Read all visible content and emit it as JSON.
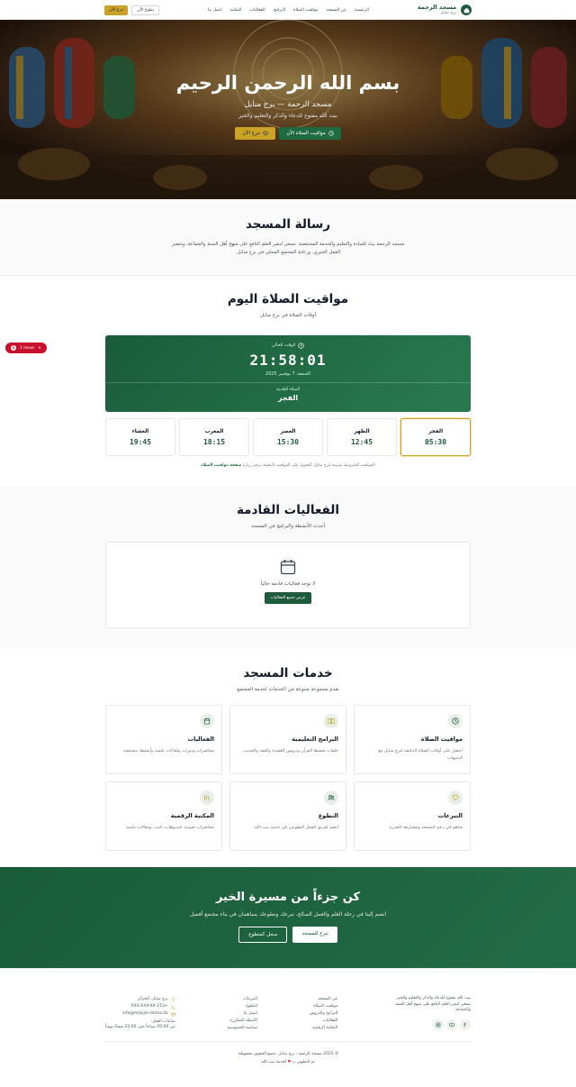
{
  "header": {
    "brand_name": "مسجد الرحمة",
    "brand_sub": "برج منايل",
    "nav": [
      "الرئيسية",
      "عن المسجد",
      "مواقيت الصلاة",
      "البرامج",
      "الفعاليات",
      "المكتبة",
      "اتصل بنا"
    ],
    "volunteer": "تطوع الآن",
    "donate": "تبرع الآن"
  },
  "hero": {
    "title": "بسم الله الرحمن الرحيم",
    "subtitle": "مسجد الرحمة — برج منايل",
    "tagline": "بيت الله مفتوح للدعاء والذكر والتعليم والخير",
    "btn_prayer": "مواقيت الصلاة الآن",
    "btn_donate": "تبرع الآن"
  },
  "mission": {
    "title": "رسالة المسجد",
    "text": "مسجد الرحمة بيتٌ للعبادة والتعليم والخدمة المجتمعية. نسعى لنشر العلم النافع على منهج أهل السنة والجماعة، وتحفيز العمل الخيري، ورعاية المجتمع المحلي في برج منايل."
  },
  "prayer": {
    "title": "مواقيت الصلاة اليوم",
    "subtitle": "أوقات الصلاة في برج منايل",
    "current_label": "الوقت الحالي",
    "current_time": "21:58:01",
    "date": "الجمعة، 7 نوفمبر 2025",
    "next_label": "الصلاة القادمة",
    "next_prayer": "الفجر",
    "times": [
      {
        "name": "الفجر",
        "time": "05:30"
      },
      {
        "name": "الظهر",
        "time": "12:45"
      },
      {
        "name": "العصر",
        "time": "15:30"
      },
      {
        "name": "المغرب",
        "time": "18:15"
      },
      {
        "name": "العشاء",
        "time": "19:45"
      }
    ],
    "note": "المواقيت المعروضة تقريبية لبرج منايل. للتحويل على المواقيت الدقيقة، يرجى زيارة",
    "note_link": "صفحة مواقيت الصلاة"
  },
  "events": {
    "title": "الفعاليات القادمة",
    "subtitle": "أحدث الأنشطة والبرامج في المسجد",
    "empty": "لا توجد فعاليات قادمة حالياً",
    "button": "عرض جميع الفعاليات"
  },
  "services": {
    "title": "خدمات المسجد",
    "subtitle": "نقدم مجموعة متنوعة من الخدمات لخدمة المجتمع",
    "items": [
      {
        "title": "مواقيت الصلاة",
        "desc": "احصل على أوقات الصلاة الدقيقة لبرج منايل مع التنبيهات",
        "icon": "clock-icon"
      },
      {
        "title": "البرامج التعليمية",
        "desc": "حلقات تحفيظ القرآن ودروس العقيدة والفقه والحديث",
        "icon": "book-icon"
      },
      {
        "title": "الفعاليات",
        "desc": "محاضرات ودورات ولقاءات علمية وأنشطة مجتمعية",
        "icon": "calendar-icon"
      },
      {
        "title": "التبرعات",
        "desc": "ساهم في دعم المسجد ومشاريعه الخيرية",
        "icon": "heart-icon"
      },
      {
        "title": "التطوع",
        "desc": "انضم لفريق العمل التطوعي في خدمة بيت الله",
        "icon": "users-icon"
      },
      {
        "title": "المكتبة الرقمية",
        "desc": "محاضرات صوتية، فيديوهات، كتب، ومقالات علمية",
        "icon": "library-icon"
      }
    ]
  },
  "cta": {
    "title": "كن جزءاً من مسيرة الخير",
    "text": "انضم إلينا في رحلة العلم والعمل الصالح. تبرعك وتطوعك يساهمان في بناء مجتمع أفضل",
    "donate": "تبرع للمسجد",
    "volunteer": "سجل كمتطوع"
  },
  "footer": {
    "about": "بيت الله مفتوح للدعاء والذكر والتعليم والخير. نسعى لنشر العلم النافع على منهج أهل السنة والجماعة.",
    "links1": [
      "عن المسجد",
      "مواقيت الصلاة",
      "البرامج والدروس",
      "الفعاليات",
      "المكتبة الرقمية"
    ],
    "links2": [
      "التبرعات",
      "التطوع",
      "اتصل بنا",
      "الأسئلة المتكررة",
      "سياسة الخصوصية"
    ],
    "address": "برج منايل، الجزائر",
    "phone": "+213-XXX-XXX-XX",
    "email": "info@masjid-rahma.dz",
    "hours_label": "ساعات العمل:",
    "hours": "من 05:00 صباحاً حتى 22:00 مساءً يومياً",
    "copyright": "© 2025 مسجد الرحمة - برج منايل. جميع الحقوق محفوظة.",
    "dev_prefix": "تم التطوير ب",
    "dev_suffix": "لخدمة بيت الله"
  },
  "issue_badge": {
    "count": "1",
    "label": "1 Issue"
  },
  "colors": {
    "primary": "#1e5a3c",
    "gold": "#c9a227",
    "badge": "#c8102e"
  }
}
